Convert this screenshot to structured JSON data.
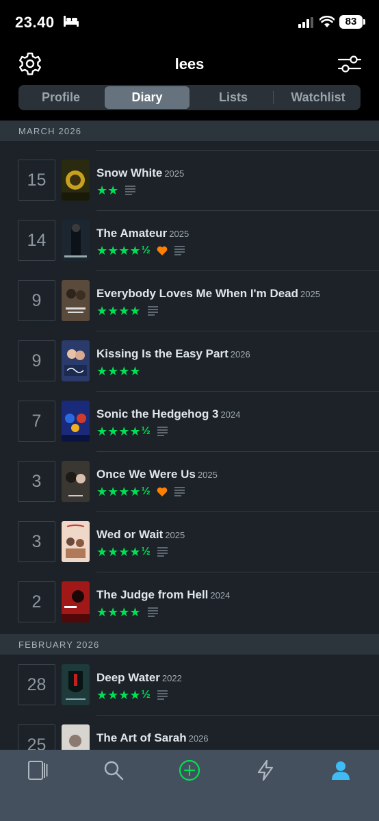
{
  "status_bar": {
    "time": "23.40",
    "battery": "83"
  },
  "header": {
    "title": "lees"
  },
  "tabs": [
    {
      "label": "Profile"
    },
    {
      "label": "Diary"
    },
    {
      "label": "Lists"
    },
    {
      "label": "Watchlist"
    }
  ],
  "sections": [
    {
      "label": "MARCH 2026"
    },
    {
      "label": "FEBRUARY 2026"
    }
  ],
  "entries": [
    {
      "day": "15",
      "title": "Snow White",
      "year": "2025",
      "stars": "★★",
      "half": "",
      "liked": false,
      "review": true
    },
    {
      "day": "14",
      "title": "The Amateur",
      "year": "2025",
      "stars": "★★★★",
      "half": "½",
      "liked": true,
      "review": true
    },
    {
      "day": "9",
      "title": "Everybody Loves Me When I'm Dead",
      "year": "2025",
      "stars": "★★★★",
      "half": "",
      "liked": false,
      "review": true
    },
    {
      "day": "9",
      "title": "Kissing Is the Easy Part",
      "year": "2026",
      "stars": "★★★★",
      "half": "",
      "liked": false,
      "review": false
    },
    {
      "day": "7",
      "title": "Sonic the Hedgehog 3",
      "year": "2024",
      "stars": "★★★★",
      "half": "½",
      "liked": false,
      "review": true
    },
    {
      "day": "3",
      "title": "Once We Were Us",
      "year": "2025",
      "stars": "★★★★",
      "half": "½",
      "liked": true,
      "review": true
    },
    {
      "day": "3",
      "title": "Wed or Wait",
      "year": "2025",
      "stars": "★★★★",
      "half": "½",
      "liked": false,
      "review": true
    },
    {
      "day": "2",
      "title": "The Judge from Hell",
      "year": "2024",
      "stars": "★★★★",
      "half": "",
      "liked": false,
      "review": true
    },
    {
      "day": "28",
      "title": "Deep Water",
      "year": "2022",
      "stars": "★★★★",
      "half": "½",
      "liked": false,
      "review": true
    },
    {
      "day": "25",
      "title": "The Art of Sarah",
      "year": "2026",
      "stars": "",
      "half": "",
      "liked": false,
      "review": false
    }
  ],
  "tabbar": [
    "films-icon",
    "search-icon",
    "add-icon",
    "activity-icon",
    "profile-icon"
  ],
  "colors": {
    "star": "#00e054",
    "heart": "#ff8000",
    "active_tab": "#40bcf4",
    "add": "#00e054"
  }
}
